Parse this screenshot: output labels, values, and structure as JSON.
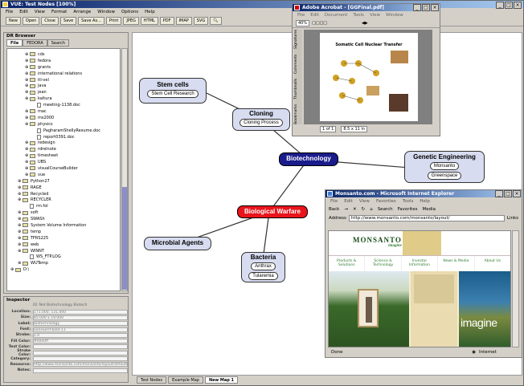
{
  "app": {
    "title": "VUE: Test Nodes [100%]",
    "menu": [
      "File",
      "Edit",
      "View",
      "Format",
      "Arrange",
      "Window",
      "Options",
      "Help"
    ],
    "toolbar": [
      "New",
      "Open",
      "Close",
      "Save",
      "Save As...",
      "Print",
      "JPEG",
      "HTML",
      "PDF",
      "IMAP",
      "SVG"
    ],
    "window_controls": [
      "_",
      "□",
      "×"
    ]
  },
  "browser": {
    "title": "DR Browser",
    "tabs": [
      "File",
      "FEDORA",
      "Search"
    ],
    "tree": [
      {
        "depth": 2,
        "type": "folder",
        "label": "cds"
      },
      {
        "depth": 2,
        "type": "folder",
        "label": "fedora"
      },
      {
        "depth": 2,
        "type": "folder",
        "label": "grants"
      },
      {
        "depth": 2,
        "type": "folder",
        "label": "international relations"
      },
      {
        "depth": 2,
        "type": "folder",
        "label": "itl-vel"
      },
      {
        "depth": 2,
        "type": "folder",
        "label": "java"
      },
      {
        "depth": 2,
        "type": "folder",
        "label": "jean"
      },
      {
        "depth": 2,
        "type": "folder",
        "label": "kaltura"
      },
      {
        "depth": 3,
        "type": "file",
        "label": "meeting-1138.doc"
      },
      {
        "depth": 2,
        "type": "folder",
        "label": "mac"
      },
      {
        "depth": 2,
        "type": "folder",
        "label": "ms2000"
      },
      {
        "depth": 2,
        "type": "folder",
        "label": "physics"
      },
      {
        "depth": 3,
        "type": "file",
        "label": "PagharamShellyResume.doc"
      },
      {
        "depth": 3,
        "type": "file",
        "label": "report0391.doc"
      },
      {
        "depth": 2,
        "type": "folder",
        "label": "redesign"
      },
      {
        "depth": 2,
        "type": "folder",
        "label": "rdrelnote"
      },
      {
        "depth": 2,
        "type": "folder",
        "label": "timesheet"
      },
      {
        "depth": 2,
        "type": "folder",
        "label": "UBS"
      },
      {
        "depth": 2,
        "type": "folder",
        "label": "visualCourseBuilder"
      },
      {
        "depth": 2,
        "type": "folder",
        "label": "vue"
      },
      {
        "depth": 1,
        "type": "folder",
        "label": "Python27"
      },
      {
        "depth": 1,
        "type": "folder",
        "label": "RAGE"
      },
      {
        "depth": 1,
        "type": "folder",
        "label": "Recycled"
      },
      {
        "depth": 1,
        "type": "folder",
        "label": "RECYCLER"
      },
      {
        "depth": 2,
        "type": "file",
        "label": "rm.fol"
      },
      {
        "depth": 1,
        "type": "folder",
        "label": "soft"
      },
      {
        "depth": 1,
        "type": "folder",
        "label": "SWASh"
      },
      {
        "depth": 1,
        "type": "folder",
        "label": "System Volume Information"
      },
      {
        "depth": 1,
        "type": "folder",
        "label": "temp"
      },
      {
        "depth": 1,
        "type": "folder",
        "label": "TFRS225"
      },
      {
        "depth": 1,
        "type": "folder",
        "label": "web"
      },
      {
        "depth": 1,
        "type": "folder",
        "label": "WINNT"
      },
      {
        "depth": 2,
        "type": "file",
        "label": "WS_FTP.LOG"
      },
      {
        "depth": 1,
        "type": "folder",
        "label": "WUTemp"
      },
      {
        "depth": 0,
        "type": "folder",
        "label": "D:\\"
      }
    ]
  },
  "inspector": {
    "title": "Inspector",
    "heading": "ID: Not Biotechnology Biotech",
    "rows": [
      {
        "label": "Location:",
        "value": "171.000, 131.000"
      },
      {
        "label": "Size:",
        "value": "85.000 x 19.000"
      },
      {
        "label": "Label:",
        "value": "Biotechnology"
      },
      {
        "label": "Font:",
        "value": "SansSerif-bold-11"
      },
      {
        "label": "Stroke:",
        "value": "1.0"
      },
      {
        "label": "Fill Color:",
        "value": "#e0e0ff"
      },
      {
        "label": "Text Color:",
        "value": ""
      },
      {
        "label": "Stroke Color:",
        "value": ""
      },
      {
        "label": "Category:",
        "value": ""
      },
      {
        "label": "Resource:",
        "value": "http://www.monsanto.com/monsanto/layout/default.asp"
      },
      {
        "label": "Notes:",
        "value": ""
      }
    ]
  },
  "map": {
    "tabs": [
      "Test Nodes",
      "Example Map",
      "New Map 1"
    ],
    "nodes": {
      "stem_cells": {
        "title": "Stem cells",
        "child": "Stem Cell Research"
      },
      "cloning": {
        "title": "Cloning",
        "child": "Cloning Process"
      },
      "biotech": {
        "title": "Biotechnology"
      },
      "genetic": {
        "title": "Genetic Engineering",
        "children": [
          "Monsanto",
          "Greenspace"
        ]
      },
      "bio_warfare": {
        "title": "Biological Warfare"
      },
      "microbial": {
        "title": "Microbial Agents"
      },
      "bacteria": {
        "title": "Bacteria",
        "children": [
          "Anthrax",
          "Tularemia"
        ]
      }
    }
  },
  "acrobat": {
    "title": "Adobe Acrobat - [GGFinal.pdf]",
    "menu": [
      "File",
      "Edit",
      "Document",
      "Tools",
      "View",
      "Window"
    ],
    "zoom": "40%",
    "page": "1 of 1",
    "size": "8.5 x 11 in",
    "side_tabs": [
      "Bookmarks",
      "Thumbnails",
      "Comments",
      "Signatures"
    ],
    "doc_title": "Somatic Cell Nuclear Transfer"
  },
  "ie": {
    "title": "Monsanto.com - Microsoft Internet Explorer",
    "menu": [
      "File",
      "Edit",
      "View",
      "Favorites",
      "Tools",
      "Help"
    ],
    "toolbar": [
      "Back",
      "→",
      "✕",
      "↻",
      "⌂",
      "Search",
      "Favorites",
      "Media"
    ],
    "address_label": "Address",
    "url": "http://www.monsanto.com/monsanto/layout/",
    "links_label": "Links",
    "brand": "MONSANTO",
    "brand_sub": "imagine",
    "nav": [
      "Products & Solutions",
      "Science & Technology",
      "Investor Information",
      "News & Media",
      "About Us"
    ],
    "hero_text": "imagine",
    "status_left": "Done",
    "status_right": "Internet"
  },
  "colors": {
    "titlebar": "#0a246a",
    "node_fill": "#d8dcf0",
    "biotech_fill": "#1a1c8c",
    "warfare_fill": "#e8141c",
    "map_link": "#333333",
    "monsanto_green": "#2e7d2e"
  }
}
